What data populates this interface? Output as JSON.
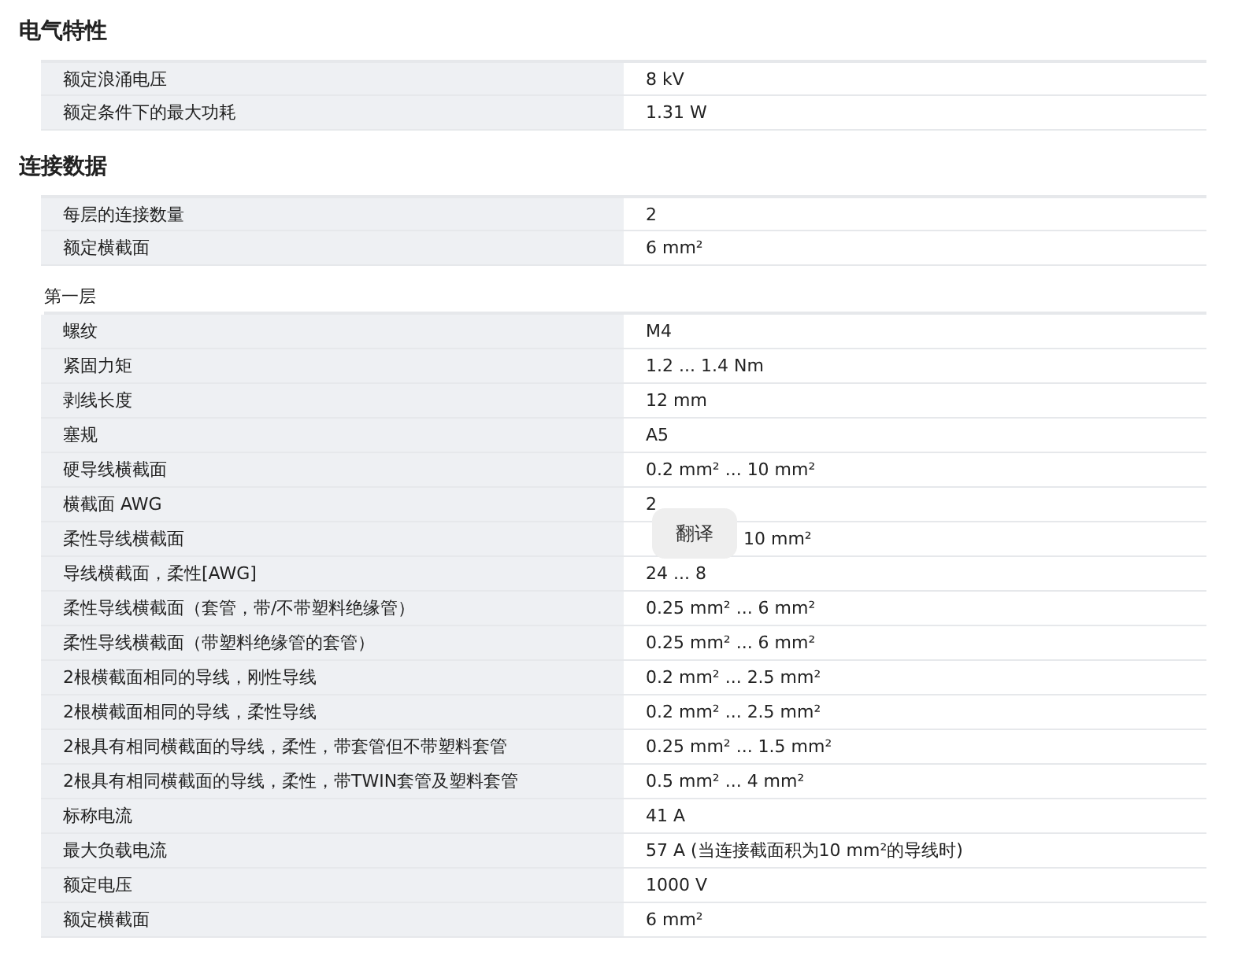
{
  "sections": [
    {
      "title": "电气特性",
      "groups": [
        {
          "rows": [
            {
              "label": "额定浪涌电压",
              "value": "8 kV"
            },
            {
              "label": "额定条件下的最大功耗",
              "value": "1.31 W"
            }
          ]
        }
      ]
    },
    {
      "title": "连接数据",
      "groups": [
        {
          "rows": [
            {
              "label": "每层的连接数量",
              "value": "2"
            },
            {
              "label": "额定横截面",
              "value": "6 mm²"
            }
          ]
        },
        {
          "subtitle": "第一层",
          "rows": [
            {
              "label": "螺纹",
              "value": "M4"
            },
            {
              "label": "紧固力矩",
              "value": "1.2 ... 1.4 Nm"
            },
            {
              "label": "剥线长度",
              "value": "12 mm"
            },
            {
              "label": "塞规",
              "value": "A5"
            },
            {
              "label": "硬导线横截面",
              "value": "0.2 mm² ... 10 mm²"
            },
            {
              "label": "横截面 AWG",
              "value": "2"
            },
            {
              "label": "柔性导线横截面",
              "value": "10 mm²",
              "covered": true
            },
            {
              "label": "导线横截面，柔性[AWG]",
              "value": "24 ... 8"
            },
            {
              "label": "柔性导线横截面（套管，带/不带塑料绝缘管）",
              "value": "0.25 mm² ... 6 mm²"
            },
            {
              "label": "柔性导线横截面（带塑料绝缘管的套管）",
              "value": "0.25 mm² ... 6 mm²"
            },
            {
              "label": "2根横截面相同的导线，刚性导线",
              "value": "0.2 mm² ... 2.5 mm²"
            },
            {
              "label": "2根横截面相同的导线，柔性导线",
              "value": "0.2 mm² ... 2.5 mm²"
            },
            {
              "label": "2根具有相同横截面的导线，柔性，带套管但不带塑料套管",
              "value": "0.25 mm² ... 1.5 mm²"
            },
            {
              "label": "2根具有相同横截面的导线，柔性，带TWIN套管及塑料套管",
              "value": "0.5 mm² ... 4 mm²"
            },
            {
              "label": "标称电流",
              "value": "41 A"
            },
            {
              "label": "最大负载电流",
              "value": "57 A (当连接截面积为10 mm²的导线时)"
            },
            {
              "label": "额定电压",
              "value": "1000 V"
            },
            {
              "label": "额定横截面",
              "value": "6 mm²"
            }
          ]
        }
      ]
    }
  ],
  "translate_popup": {
    "label": "翻译"
  }
}
